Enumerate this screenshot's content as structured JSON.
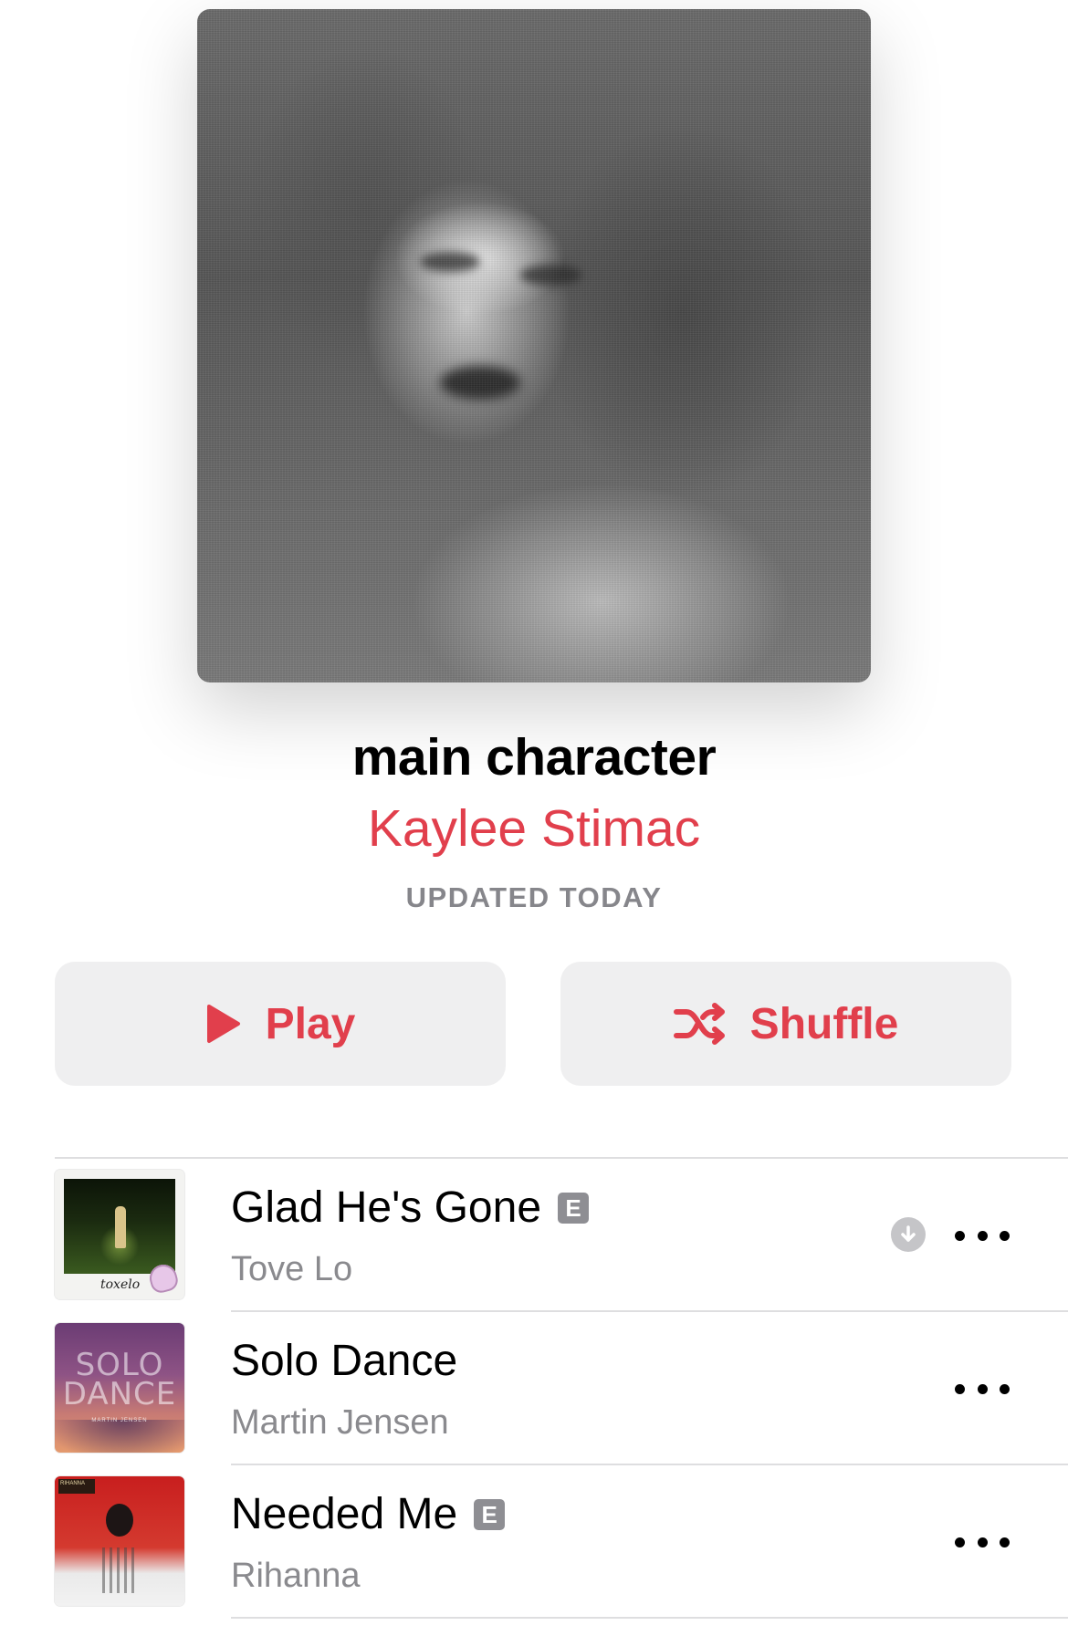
{
  "playlist": {
    "title": "main character",
    "curator": "Kaylee Stimac",
    "updated": "UPDATED TODAY",
    "artwork_icon": "playlist-artwork-image"
  },
  "actions": {
    "play_label": "Play",
    "shuffle_label": "Shuffle",
    "play_icon": "play-icon",
    "shuffle_icon": "shuffle-icon"
  },
  "colors": {
    "accent": "#e13f4c",
    "secondary_text": "#86868b",
    "button_bg": "#efeff0"
  },
  "tracks": [
    {
      "title": "Glad He's Gone",
      "artist": "Tove Lo",
      "explicit": "E",
      "downloaded": true,
      "cover_signature": "toxelo"
    },
    {
      "title": "Solo Dance",
      "artist": "Martin Jensen",
      "explicit": "",
      "downloaded": false,
      "cover_text": "SOLO DANCE",
      "cover_credits": "MARTIN JENSEN"
    },
    {
      "title": "Needed Me",
      "artist": "Rihanna",
      "explicit": "E",
      "downloaded": false,
      "cover_label": "RIHANNA"
    }
  ]
}
